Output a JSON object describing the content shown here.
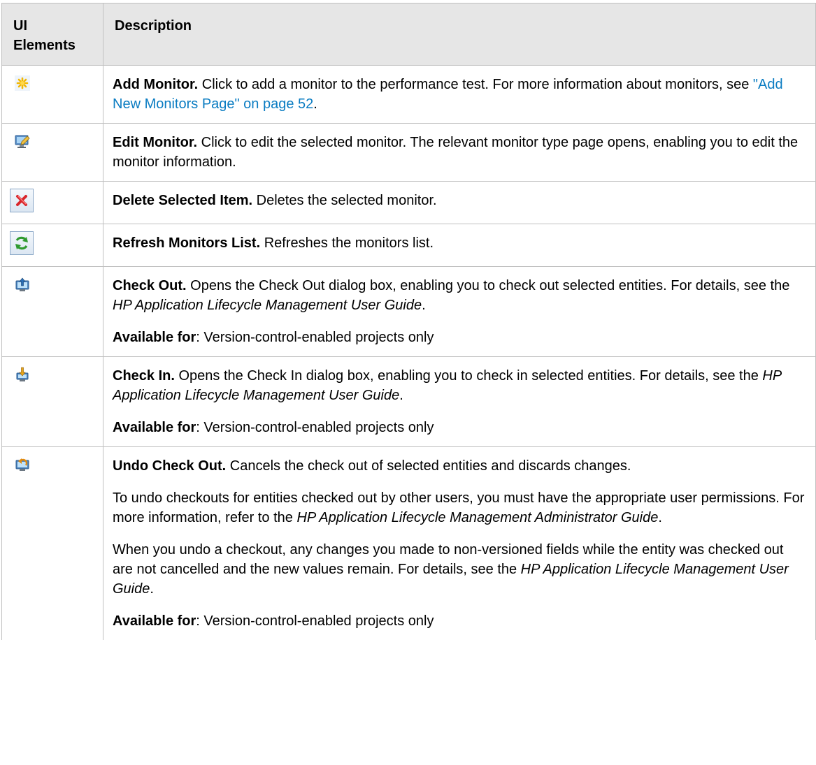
{
  "header": {
    "col1_line1": "UI",
    "col1_line2": "Elements",
    "col2": "Description"
  },
  "rows": {
    "add": {
      "icon": "add-monitor-icon",
      "title": "Add Monitor.",
      "text": " Click to add a monitor to the performance test. For more information about monitors, see ",
      "link": "\"Add New Monitors Page\" on page 52",
      "tail": "."
    },
    "edit": {
      "icon": "edit-monitor-icon",
      "title": "Edit Monitor.",
      "text": " Click to edit the selected monitor. The relevant monitor type page opens, enabling you to edit the monitor information."
    },
    "delete": {
      "icon": "delete-icon",
      "title": "Delete Selected Item.",
      "text": " Deletes the selected monitor."
    },
    "refresh": {
      "icon": "refresh-icon",
      "title": "Refresh Monitors List.",
      "text": " Refreshes the monitors list."
    },
    "checkout": {
      "icon": "check-out-icon",
      "title": "Check Out.",
      "text": " Opens the Check Out dialog box, enabling you to check out selected entities. For details, see the ",
      "guide": "HP Application Lifecycle Management User Guide",
      "tail": ".",
      "avail_label": "Available for",
      "avail_text": ": Version-control-enabled projects only"
    },
    "checkin": {
      "icon": "check-in-icon",
      "title": "Check In.",
      "text": " Opens the Check In dialog box, enabling you to check in selected entities. For details, see the ",
      "guide": "HP Application Lifecycle Management User Guide",
      "tail": ".",
      "avail_label": "Available for",
      "avail_text": ": Version-control-enabled projects only"
    },
    "undo": {
      "icon": "undo-check-out-icon",
      "title": "Undo Check Out.",
      "text": " Cancels the check out of selected entities and discards changes.",
      "p2_text": "To undo checkouts for entities checked out by other users, you must have the appropriate user permissions. For more information, refer to the ",
      "p2_guide": "HP Application Lifecycle Management Administrator Guide",
      "p2_tail": ".",
      "p3_text": "When you undo a checkout, any changes you made to non-versioned fields while the entity was checked out are not cancelled and the new values remain. For details, see the ",
      "p3_guide": "HP Application Lifecycle Management User Guide",
      "p3_tail": ".",
      "avail_label": "Available for",
      "avail_text": ": Version-control-enabled projects only"
    }
  },
  "colors": {
    "header_bg": "#e6e6e6",
    "border": "#c0c0c0",
    "link": "#0a7cc2"
  }
}
